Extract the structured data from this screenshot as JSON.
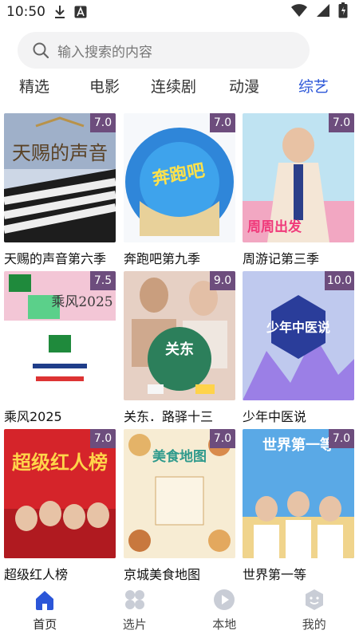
{
  "status_bar": {
    "time": "10:50"
  },
  "search": {
    "placeholder": "输入搜索的内容"
  },
  "tabs": [
    {
      "label": "精选",
      "active": false
    },
    {
      "label": "电影",
      "active": false
    },
    {
      "label": "连续剧",
      "active": false
    },
    {
      "label": "动漫",
      "active": false
    },
    {
      "label": "综艺",
      "active": true
    }
  ],
  "items": [
    {
      "title": "天赐的声音第六季",
      "rating": "7.0",
      "poster_text": "天赐的声音"
    },
    {
      "title": "奔跑吧第九季",
      "rating": "7.0",
      "poster_text": "奔跑吧"
    },
    {
      "title": "周游记第三季",
      "rating": "7.0",
      "poster_text": "周周出发"
    },
    {
      "title": "乘风2025",
      "rating": "7.5",
      "poster_text": "乘风2025"
    },
    {
      "title": "关东．路驿十三",
      "rating": "9.0",
      "poster_text": "关东"
    },
    {
      "title": "少年中医说",
      "rating": "10.0",
      "poster_text": "少年中医说"
    },
    {
      "title": "超级红人榜",
      "rating": "7.0",
      "poster_text": "超级红人榜"
    },
    {
      "title": "京城美食地图",
      "rating": "7.0",
      "poster_text": "美食地图"
    },
    {
      "title": "世界第一等",
      "rating": "7.0",
      "poster_text": "世界第一等"
    }
  ],
  "bottom_nav": [
    {
      "label": "首页",
      "icon": "home-icon",
      "active": true
    },
    {
      "label": "选片",
      "icon": "grid-icon",
      "active": false
    },
    {
      "label": "本地",
      "icon": "play-icon",
      "active": false
    },
    {
      "label": "我的",
      "icon": "profile-icon",
      "active": false
    }
  ],
  "colors": {
    "accent": "#2b56d8",
    "rating_bg": "#6d4d7d"
  }
}
